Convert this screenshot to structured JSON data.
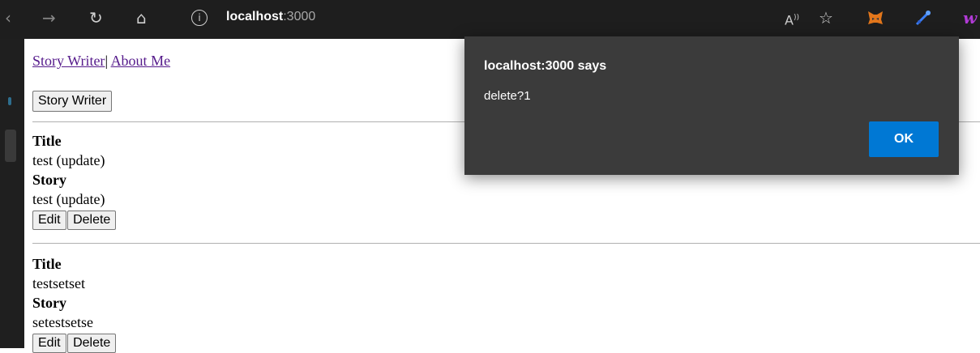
{
  "browser": {
    "address": {
      "host": "localhost",
      "port": ":3000"
    },
    "icons": [
      "back-icon",
      "forward-icon",
      "refresh-icon",
      "home-icon",
      "info-icon",
      "read-aloud-icon",
      "favorites-icon",
      "metamask-icon",
      "extension-icon",
      "extension-w-icon"
    ]
  },
  "nav": {
    "link1": "Story Writer",
    "separator": "|",
    "link2": "About Me"
  },
  "top_button": "Story Writer",
  "entries": [
    {
      "title_label": "Title",
      "title": "test (update)",
      "story_label": "Story",
      "story": "test (update)",
      "edit": "Edit",
      "delete": "Delete"
    },
    {
      "title_label": "Title",
      "title": "testsetset",
      "story_label": "Story",
      "story": "setestsetse",
      "edit": "Edit",
      "delete": "Delete"
    }
  ],
  "dialog": {
    "title": "localhost:3000 says",
    "message": "delete?1",
    "ok": "OK"
  },
  "colors": {
    "accent": "#0078d4",
    "dialog_bg": "#3b3b3b",
    "link": "#551a8b"
  }
}
